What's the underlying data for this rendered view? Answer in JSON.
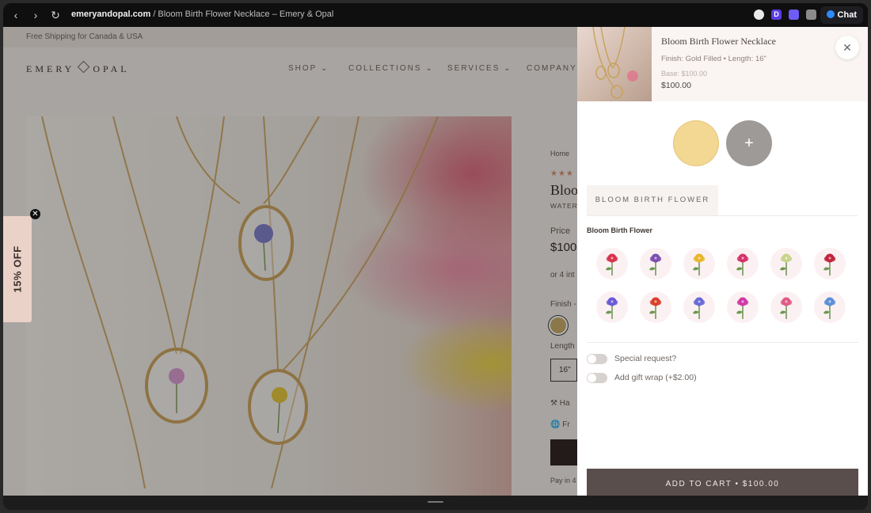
{
  "browser": {
    "domain": "emeryandopal.com",
    "path": " / Bloom Birth Flower Necklace – Emery & Opal",
    "chat_label": "Chat",
    "ext_d": "D"
  },
  "site": {
    "promo": "Free Shipping for Canada & USA",
    "logo_left": "EMERY",
    "logo_right": "OPAL",
    "nav": [
      "SHOP",
      "COLLECTIONS",
      "SERVICES",
      "COMPANY"
    ],
    "breadcrumb": "Home",
    "title_partial": "Bloo",
    "subtitle_partial": "WATER",
    "price_label": "Price",
    "price_partial": "$100",
    "installments_partial": "or 4 int",
    "finish_partial": "Finish -",
    "length_partial": "Length",
    "length_value": "16\"",
    "shipping_partial": "Fr",
    "handmade_partial": "Ha",
    "payin_partial": "Pay in 4",
    "discount_label": "15% OFF"
  },
  "drawer": {
    "product_name": "Bloom Birth Flower Necklace",
    "finish_line": "Finish: Gold Filled • Length: 16\"",
    "base_price": "Base: $100.00",
    "price": "$100.00",
    "plus": "+",
    "tab_label": "BLOOM BIRTH FLOWER",
    "section_label": "Bloom Birth Flower",
    "flowers": [
      {
        "name": "carnation",
        "color": "#d8334f"
      },
      {
        "name": "violet",
        "color": "#7b4fb0"
      },
      {
        "name": "daffodil",
        "color": "#e8b62a"
      },
      {
        "name": "tulip",
        "color": "#d6336b"
      },
      {
        "name": "lily-of-the-valley",
        "color": "#c7d48a"
      },
      {
        "name": "rose",
        "color": "#c2253d"
      },
      {
        "name": "larkspur",
        "color": "#6a5bd6"
      },
      {
        "name": "poppy",
        "color": "#d9402d"
      },
      {
        "name": "aster",
        "color": "#6b6ad8"
      },
      {
        "name": "cosmos",
        "color": "#d13aa8"
      },
      {
        "name": "peony",
        "color": "#e25a87"
      },
      {
        "name": "forget-me-not",
        "color": "#5d8fd6"
      }
    ],
    "special_request": "Special request?",
    "gift_wrap": "Add gift wrap (+$2.00)",
    "add_to_cart": "ADD TO CART • $100.00"
  }
}
